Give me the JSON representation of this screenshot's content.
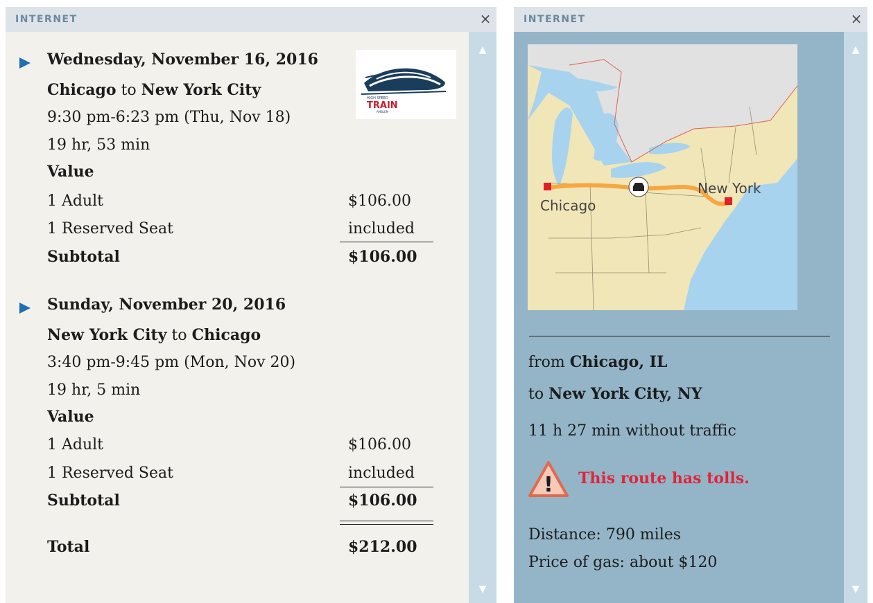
{
  "left_window": {
    "title": "INTERNET",
    "close_glyph": "×",
    "logo": {
      "small_text": "HIGH SPEED",
      "brand": "TRAIN",
      "tag": "AMBLEM"
    },
    "trips": [
      {
        "date": "Wednesday, November 16, 2016",
        "from": "Chicago",
        "to_word": "to",
        "to": "New York City",
        "times": "9:30 pm-6:23 pm (Thu, Nov 18)",
        "duration": "19 hr, 53 min",
        "fare_label": "Value",
        "adult_label": "1 Adult",
        "adult_price": "$106.00",
        "seat_label": "1 Reserved Seat",
        "seat_price": "included",
        "subtotal_label": "Subtotal",
        "subtotal": "$106.00"
      },
      {
        "date": "Sunday, November 20, 2016",
        "from": "New York City",
        "to_word": "to",
        "to": "Chicago",
        "times": "3:40 pm-9:45 pm (Mon, Nov 20)",
        "duration": "19 hr, 5 min",
        "fare_label": "Value",
        "adult_label": "1 Adult",
        "adult_price": "$106.00",
        "seat_label": "1 Reserved Seat",
        "seat_price": "included",
        "subtotal_label": "Subtotal",
        "subtotal": "$106.00"
      }
    ],
    "total_label": "Total",
    "total": "$212.00"
  },
  "right_window": {
    "title": "INTERNET",
    "close_glyph": "×",
    "map": {
      "label_chicago": "Chicago",
      "label_newyork": "New York"
    },
    "from_word": "from",
    "from_city": "Chicago, IL",
    "to_word": "to",
    "to_city": "New York City, NY",
    "drive_time": "11 h 27 min without traffic",
    "warning": "This route has tolls.",
    "warning_glyph": "!",
    "distance": "Distance: 790 miles",
    "gas_price": "Price of gas: about $120"
  },
  "colors": {
    "accent_arrow": "#1f6fb5",
    "warning_red": "#e0243a",
    "route_orange": "#f5a742",
    "left_panel_bg": "#f3f1ec",
    "right_panel_bg": "#94b5c8"
  },
  "icons": {
    "close": "close-icon",
    "scroll_up": "scroll-up-arrow-icon",
    "scroll_down": "scroll-down-arrow-icon",
    "bullet": "play-arrow-icon",
    "car": "car-icon",
    "warning": "warning-triangle-icon"
  }
}
